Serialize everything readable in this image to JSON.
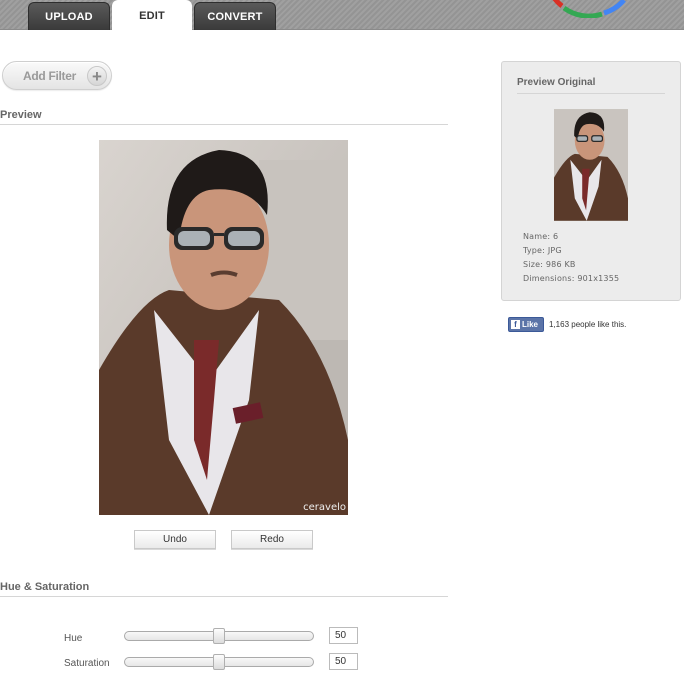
{
  "tabs": [
    {
      "label": "UPLOAD",
      "active": false
    },
    {
      "label": "EDIT",
      "active": true
    },
    {
      "label": "CONVERT",
      "active": false
    }
  ],
  "add_filter": {
    "label": "Add Filter",
    "icon": "plus-icon"
  },
  "preview": {
    "title": "Preview",
    "watermark": "ceravelo"
  },
  "history": {
    "undo_label": "Undo",
    "redo_label": "Redo"
  },
  "hue_saturation": {
    "title": "Hue & Saturation",
    "hue_label": "Hue",
    "hue_value": "50",
    "saturation_label": "Saturation",
    "saturation_value": "50"
  },
  "original": {
    "title": "Preview Original",
    "name": "Name: 6",
    "type": "Type: JPG",
    "size": "Size: 986 KB",
    "dimensions": "Dimensions: 901x1355"
  },
  "facebook": {
    "like_label": "Like",
    "count_text": "1,163 people like this."
  },
  "colors": {
    "accent_fb": "#3b5998",
    "tab_dark": "#3a3a3a",
    "topbar": "#9a9a9a"
  }
}
